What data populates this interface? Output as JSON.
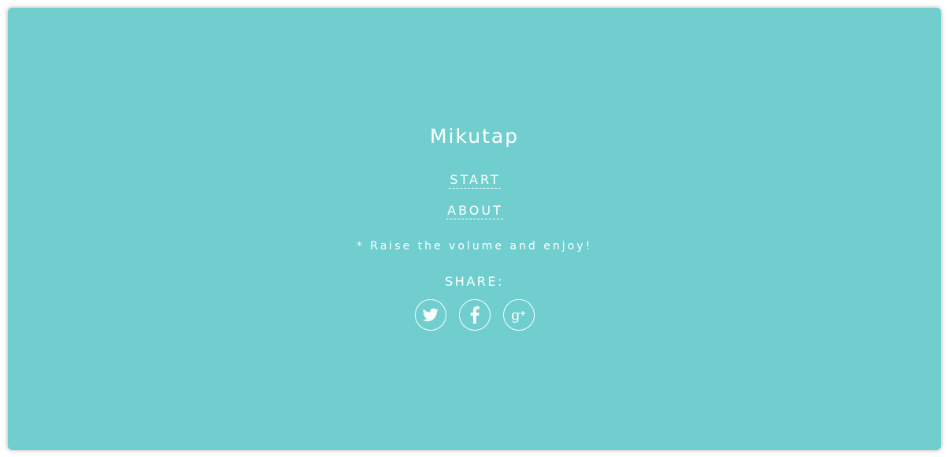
{
  "app": {
    "title": "Mikutap",
    "background_color": "#70CECE",
    "text_color": "#FFFFFF"
  },
  "menu": {
    "start_label": "START",
    "about_label": "ABOUT"
  },
  "note": "* Raise the volume and enjoy!",
  "share": {
    "label": "SHARE:",
    "buttons": [
      {
        "icon": "twitter-icon"
      },
      {
        "icon": "facebook-icon"
      },
      {
        "icon": "google-plus-icon"
      }
    ]
  }
}
